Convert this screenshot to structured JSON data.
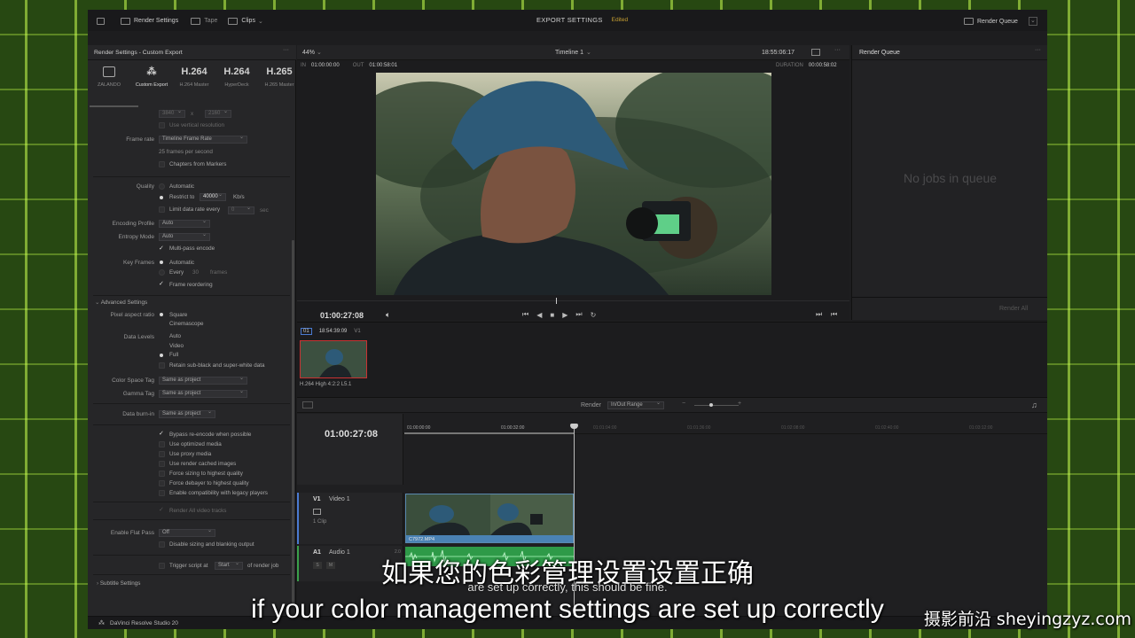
{
  "topbar": {
    "render_settings": "Render Settings",
    "tape": "Tape",
    "clips": "Clips",
    "title": "EXPORT SETTINGS",
    "edited": "Edited",
    "render_queue": "Render Queue"
  },
  "left": {
    "header": "Render Settings - Custom Export",
    "presets": [
      {
        "big": "",
        "label": "ZALANDO"
      },
      {
        "big": "",
        "label": "Custom Export"
      },
      {
        "big": "H.264",
        "label": "H.264 Master"
      },
      {
        "big": "H.264",
        "label": "HyperDeck"
      },
      {
        "big": "H.265",
        "label": "H.265 Master"
      }
    ],
    "res_a": "3840",
    "res_b": "2160",
    "use_vertical": "Use vertical resolution",
    "frame_rate_label": "Frame rate",
    "frame_rate_value": "Timeline Frame Rate",
    "fps_note": "25 frames per second",
    "chapters": "Chapters from Markers",
    "quality_label": "Quality",
    "quality_auto": "Automatic",
    "restrict_to": "Restrict to",
    "restrict_value": "40000",
    "kbps": "Kb/s",
    "limit_rate": "Limit data rate every",
    "limit_val": "0",
    "sec": "sec",
    "encoding_profile_label": "Encoding Profile",
    "encoding_profile": "Auto",
    "entropy_label": "Entropy Mode",
    "entropy": "Auto",
    "multipass": "Multi-pass encode",
    "keyframes_label": "Key Frames",
    "kf_auto": "Automatic",
    "kf_every": "Every",
    "kf_every_val": "30",
    "kf_frames": "frames",
    "frame_reorder": "Frame reordering",
    "advanced": "Advanced Settings",
    "par_label": "Pixel aspect ratio",
    "par_square": "Square",
    "par_cine": "Cinemascope",
    "levels_label": "Data Levels",
    "lv_auto": "Auto",
    "lv_video": "Video",
    "lv_full": "Full",
    "retain": "Retain sub-black and super-white data",
    "cs_tag_label": "Color Space Tag",
    "cs_tag": "Same as project",
    "gamma_tag_label": "Gamma Tag",
    "gamma_tag": "Same as project",
    "burnin_label": "Data burn-in",
    "burnin": "Same as project",
    "bypass": "Bypass re-encode when possible",
    "optimized": "Use optimized media",
    "proxy": "Use proxy media",
    "cached": "Use render cached images",
    "sizing": "Force sizing to highest quality",
    "debayer": "Force debayer to highest quality",
    "legacy": "Enable compatibility with legacy players",
    "render_alpha": "Render All video tracks",
    "flat_pass_label": "Enable Flat Pass",
    "flat_pass": "Off",
    "disable_sizing": "Disable sizing and blanking output",
    "trigger": "Trigger script at",
    "trigger_start": "Start",
    "of_render": "of render job",
    "subtitle": "Subtitle Settings"
  },
  "viewer": {
    "zoom": "44%",
    "timeline": "Timeline 1",
    "tc_top": "18:55:06:17",
    "in_label": "IN",
    "in": "01:00:00:00",
    "out_label": "OUT",
    "out": "01:00:58:01",
    "dur_label": "DURATION",
    "dur": "00:00:58:02",
    "tc": "01:00:27:08"
  },
  "queue": {
    "title": "Render Queue",
    "empty": "No jobs in queue",
    "render_all": "Render All"
  },
  "clips": {
    "index": "01",
    "tc": "18:54:39:09",
    "track": "V1",
    "codec": "H.264 High 4:2:2 L5.1"
  },
  "timeline": {
    "render_label": "Render",
    "render_range": "In/Out Range",
    "tc": "01:00:27:08",
    "ruler": [
      "01:00:00:00",
      "01:00:32:00",
      "01:01:04:00",
      "01:01:36:00",
      "01:02:08:00",
      "01:02:40:00",
      "01:03:12:00"
    ],
    "v1": "V1",
    "video1": "Video 1",
    "clip_count": "1 Clip",
    "clip_name": "C7972.MP4",
    "a1": "A1",
    "audio1": "Audio 1",
    "a_ch": "2.0",
    "s": "S",
    "m": "M"
  },
  "bottom": {
    "app": "DaVinci Resolve Studio 20"
  },
  "subs": {
    "cn": "如果您的色彩管理设置设置正确",
    "src": "are set up correctly, this should be fine.",
    "en": "if your color management settings are set up correctly",
    "watermark": "摄影前沿 sheyingzyz.com"
  }
}
